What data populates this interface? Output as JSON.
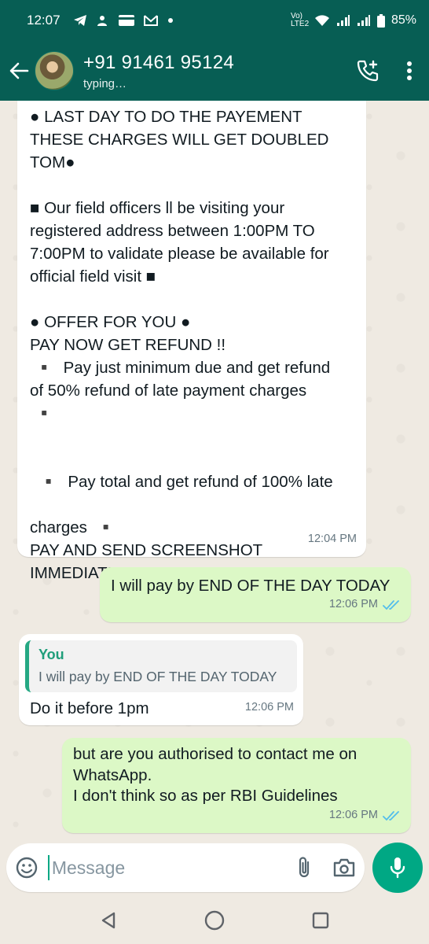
{
  "status_bar": {
    "time": "12:07",
    "network": "Vo) LTE2",
    "battery": "85%"
  },
  "header": {
    "contact_name": "+91 91461 95124",
    "status": "typing…"
  },
  "messages": {
    "m1": {
      "text": "● LAST DAY TO DO THE PAYEMENT\nTHESE CHARGES WILL GET DOUBLED\nTOM●\n\n■ Our field officers ll be visiting your\nregistered address between 1:00PM TO\n7:00PM to validate please be available for\nofficial field visit ■\n\n● OFFER FOR YOU ●\nPAY NOW GET REFUND !!\n ▪️  Pay just minimum due and get refund\nof 50% refund of late payment charges\n ▪️\n\n\n  ▪️  Pay total and get refund of 100% late\n\ncharges  ▪️\nPAY AND SEND SCREENSHOT\nIMMEDIATELY",
      "time": "12:04 PM"
    },
    "m2": {
      "text": "I will pay by END OF THE DAY TODAY",
      "time": "12:06 PM"
    },
    "m3": {
      "quote_author": "You",
      "quote_text": "I will pay by END OF THE DAY TODAY",
      "text": "Do it before 1pm",
      "time": "12:06 PM"
    },
    "m4": {
      "text": "but are you authorised to contact me on\nWhatsApp.\nI don't think so as per RBI Guidelines",
      "time": "12:06 PM"
    }
  },
  "input": {
    "placeholder": "Message"
  },
  "colors": {
    "header": "#075e54",
    "outgoing_bubble": "#dcf8c6",
    "accent": "#00a884",
    "read_ticks": "#53bdeb"
  },
  "icons": [
    "back-arrow-icon",
    "add-call-icon",
    "more-vert-icon",
    "emoji-icon",
    "attach-icon",
    "camera-icon",
    "mic-icon"
  ]
}
